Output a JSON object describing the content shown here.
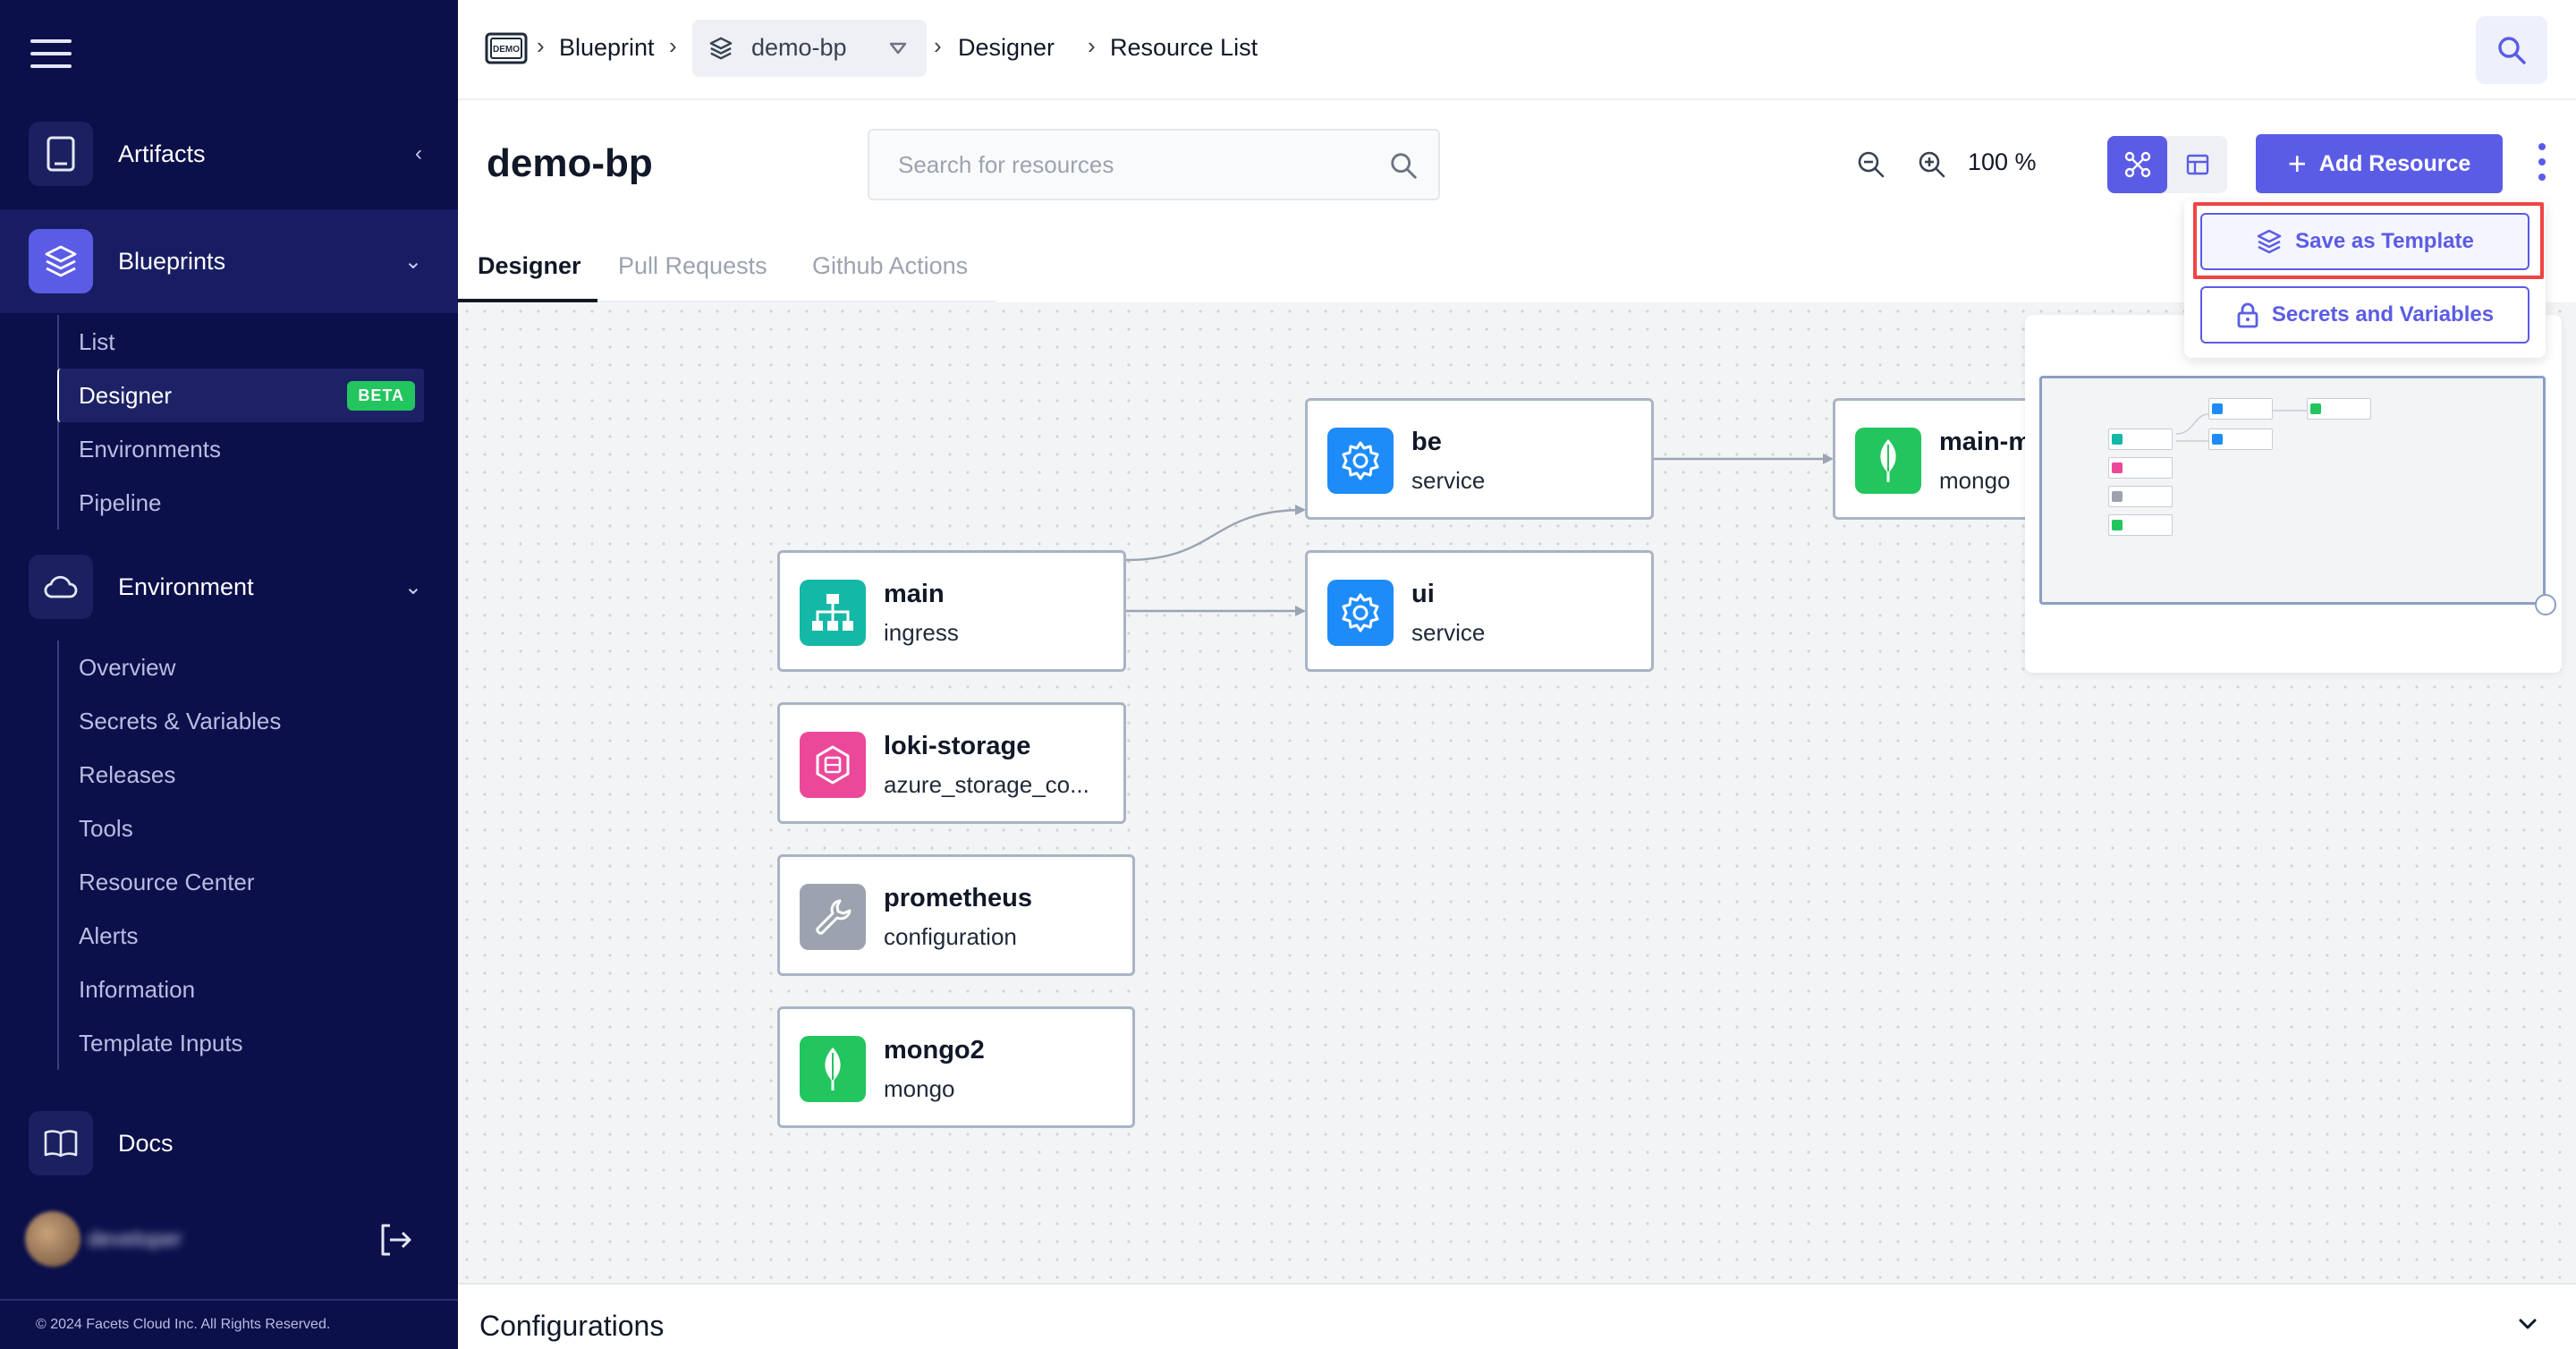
{
  "sidebar": {
    "groups": {
      "artifacts": {
        "label": "Artifacts"
      },
      "blueprints": {
        "label": "Blueprints",
        "items": [
          "List",
          "Designer",
          "Environments",
          "Pipeline"
        ],
        "badge": "BETA"
      },
      "environment": {
        "label": "Environment",
        "items": [
          "Overview",
          "Secrets & Variables",
          "Releases",
          "Tools",
          "Resource Center",
          "Alerts",
          "Information",
          "Template Inputs"
        ]
      },
      "docs": {
        "label": "Docs"
      }
    },
    "user_name": "developer",
    "copyright": "© 2024 Facets Cloud Inc. All Rights Reserved."
  },
  "breadcrumb": {
    "blueprint": "Blueprint",
    "selected_blueprint": "demo-bp",
    "designer": "Designer",
    "resource_list": "Resource List",
    "icon_text": "DEMO"
  },
  "header": {
    "title": "demo-bp",
    "search_placeholder": "Search for resources",
    "zoom_level": "100 %",
    "add_resource": "Add Resource"
  },
  "tabs": [
    "Designer",
    "Pull Requests",
    "Github Actions"
  ],
  "menu": {
    "save_as_template": "Save as Template",
    "secrets_and_variables": "Secrets and Variables"
  },
  "nodes": {
    "main": {
      "name": "main",
      "type": "ingress",
      "icon": "sitemap-icon",
      "color": "#14b8a6"
    },
    "loki": {
      "name": "loki-storage",
      "type": "azure_storage_co...",
      "icon": "storage-icon",
      "color": "#ec4899"
    },
    "prometheus": {
      "name": "prometheus",
      "type": "configuration",
      "icon": "wrench-icon",
      "color": "#9ca3af"
    },
    "mongo2": {
      "name": "mongo2",
      "type": "mongo",
      "icon": "mongo-leaf-icon",
      "color": "#22c55e"
    },
    "be": {
      "name": "be",
      "type": "service",
      "icon": "gear-icon",
      "color": "#1d8cf8"
    },
    "ui": {
      "name": "ui",
      "type": "service",
      "icon": "gear-icon",
      "color": "#1d8cf8"
    },
    "main_mongo": {
      "name": "main-m",
      "type": "mongo",
      "icon": "mongo-leaf-icon",
      "color": "#22c55e"
    }
  },
  "footer_panel": {
    "title": "Configurations"
  },
  "colors": {
    "accent": "#5b5ce6",
    "sidebar": "#0b0f4a",
    "highlight": "#ef4444"
  }
}
